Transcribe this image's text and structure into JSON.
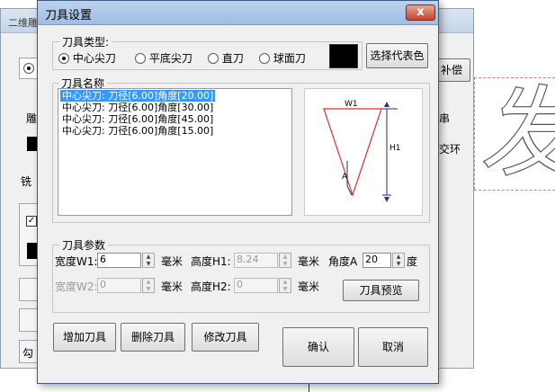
{
  "background_window": {
    "title": "二维雕",
    "right_button": "补偿",
    "label_chuan": "串",
    "label_jiaohuan": "交环",
    "label_xi": "铣",
    "label_xi2": "雕",
    "label_gou": "勾",
    "canvas_glyph": "发"
  },
  "dialog": {
    "title": "刀具设置",
    "close_label": "x",
    "tool_type": {
      "legend": "刀具类型:",
      "options": [
        "中心尖刀",
        "平底尖刀",
        "直刀",
        "球面刀"
      ],
      "selected_index": 0,
      "color_swatch": "#000000",
      "choose_color_button": "选择代表色"
    },
    "tool_name": {
      "legend": "刀具名称",
      "items": [
        "中心尖刀: 刀径[6.00]角度[20.00]",
        "中心尖刀: 刀径[6.00]角度[30.00]",
        "中心尖刀: 刀径[6.00]角度[45.00]",
        "中心尖刀: 刀径[6.00]角度[15.00]"
      ],
      "selected_index": 0,
      "preview_labels": {
        "w1": "W1",
        "h1": "H1",
        "a": "A"
      }
    },
    "params": {
      "legend": "刀具参数",
      "width_w1_label": "宽度W1:",
      "width_w1_value": "6",
      "unit1": "毫米",
      "height_h1_label": "高度H1:",
      "height_h1_value": "8.24",
      "unit2": "毫米",
      "angle_label": "角度A",
      "angle_value": "20",
      "angle_unit": "度",
      "width_w2_label": "宽度W2:",
      "width_w2_value": "0",
      "unit3": "毫米",
      "height_h2_label": "高度H2:",
      "height_h2_value": "0",
      "unit4": "毫米",
      "preview_button": "刀具预览"
    },
    "buttons": {
      "add": "增加刀具",
      "delete": "删除刀具",
      "modify": "修改刀具",
      "ok": "确认",
      "cancel": "取消"
    }
  }
}
